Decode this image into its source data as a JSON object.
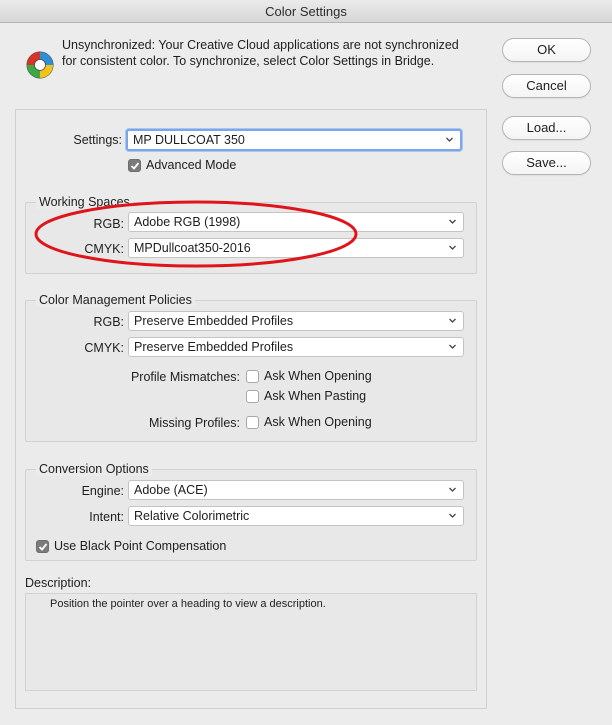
{
  "window": {
    "title": "Color Settings"
  },
  "sync": {
    "icon": "color-wheel-icon",
    "message_line1": "Unsynchronized: Your Creative Cloud applications are not synchronized",
    "message_line2": "for consistent color. To synchronize, select Color Settings in Bridge."
  },
  "buttons": {
    "ok": "OK",
    "cancel": "Cancel",
    "load": "Load...",
    "save": "Save..."
  },
  "settings": {
    "label": "Settings:",
    "value": "MP DULLCOAT 350",
    "advanced_mode_label": "Advanced Mode",
    "advanced_mode_checked": true
  },
  "working_spaces": {
    "title": "Working Spaces",
    "rgb_label": "RGB:",
    "rgb_value": "Adobe RGB (1998)",
    "cmyk_label": "CMYK:",
    "cmyk_value": "MPDullcoat350-2016"
  },
  "policies": {
    "title": "Color Management Policies",
    "rgb_label": "RGB:",
    "rgb_value": "Preserve Embedded Profiles",
    "cmyk_label": "CMYK:",
    "cmyk_value": "Preserve Embedded Profiles",
    "mismatch_label": "Profile Mismatches:",
    "mismatch_opening": "Ask When Opening",
    "mismatch_pasting": "Ask When Pasting",
    "missing_label": "Missing Profiles:",
    "missing_opening": "Ask When Opening"
  },
  "conversion": {
    "title": "Conversion Options",
    "engine_label": "Engine:",
    "engine_value": "Adobe (ACE)",
    "intent_label": "Intent:",
    "intent_value": "Relative Colorimetric",
    "bpc_label": "Use Black Point Compensation",
    "bpc_checked": true
  },
  "description": {
    "label": "Description:",
    "text": "Position the pointer over a heading to view a description."
  },
  "colors": {
    "annotation_red": "#e0141b",
    "focus_ring": "#7aa7e8",
    "checkbox_checked": "#7b7b7b"
  }
}
